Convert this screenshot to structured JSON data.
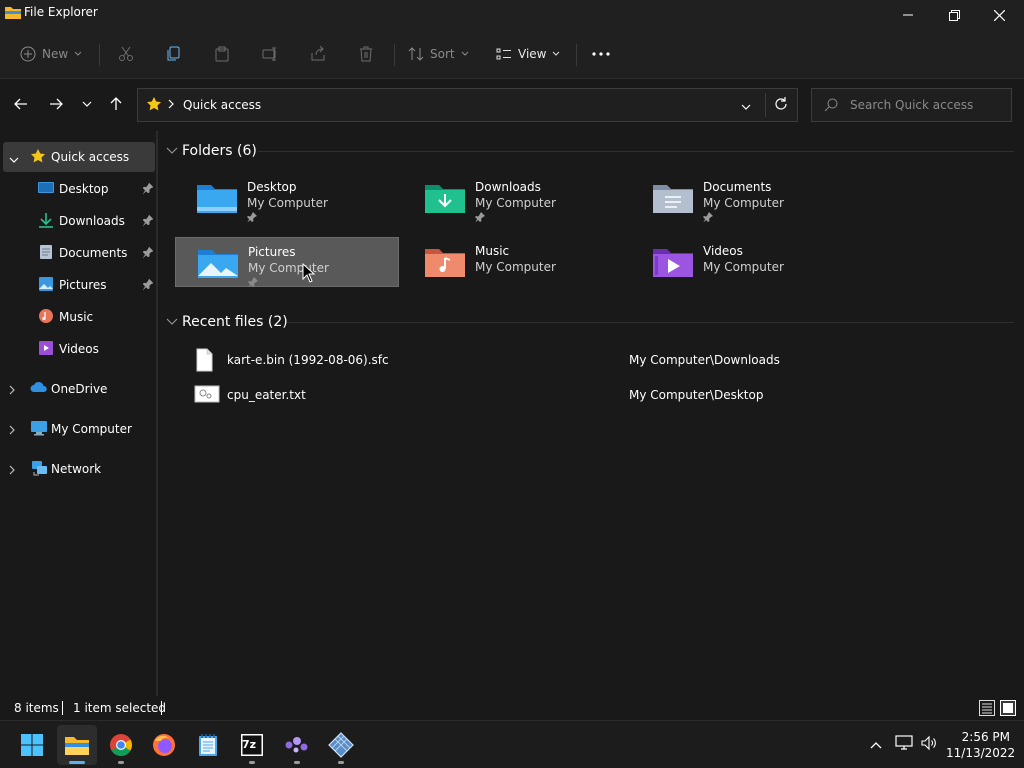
{
  "window": {
    "title": "File Explorer"
  },
  "command_bar": {
    "new_label": "New",
    "sort_label": "Sort",
    "view_label": "View"
  },
  "address": {
    "crumb": "Quick access",
    "search_placeholder": "Search Quick access"
  },
  "sidebar": {
    "quick_access": "Quick access",
    "items": [
      {
        "label": "Desktop",
        "icon": "desktop-icon",
        "pinned": true
      },
      {
        "label": "Downloads",
        "icon": "download-icon",
        "pinned": true
      },
      {
        "label": "Documents",
        "icon": "document-icon",
        "pinned": true
      },
      {
        "label": "Pictures",
        "icon": "picture-icon",
        "pinned": true
      },
      {
        "label": "Music",
        "icon": "music-icon",
        "pinned": false
      },
      {
        "label": "Videos",
        "icon": "video-icon",
        "pinned": false
      }
    ],
    "onedrive": "OneDrive",
    "my_computer": "My Computer",
    "network": "Network"
  },
  "folders": {
    "heading": "Folders (6)",
    "items": [
      {
        "name": "Desktop",
        "location": "My Computer",
        "pinned": true
      },
      {
        "name": "Downloads",
        "location": "My Computer",
        "pinned": true
      },
      {
        "name": "Documents",
        "location": "My Computer",
        "pinned": true
      },
      {
        "name": "Pictures",
        "location": "My Computer",
        "pinned": true
      },
      {
        "name": "Music",
        "location": "My Computer",
        "pinned": false
      },
      {
        "name": "Videos",
        "location": "My Computer",
        "pinned": false
      }
    ]
  },
  "recent": {
    "heading": "Recent files (2)",
    "items": [
      {
        "name": "kart-e.bin (1992-08-06).sfc",
        "path": "My Computer\\Downloads"
      },
      {
        "name": "cpu_eater.txt",
        "path": "My Computer\\Desktop"
      }
    ]
  },
  "status": {
    "count": "8 items",
    "selected": "1 item selected"
  },
  "taskbar": {
    "time": "2:56 PM",
    "date": "11/13/2022",
    "zip_label": "7z"
  },
  "colors": {
    "accent": "#5ab0f0",
    "star": "#f5c518",
    "selection": "#595959"
  }
}
